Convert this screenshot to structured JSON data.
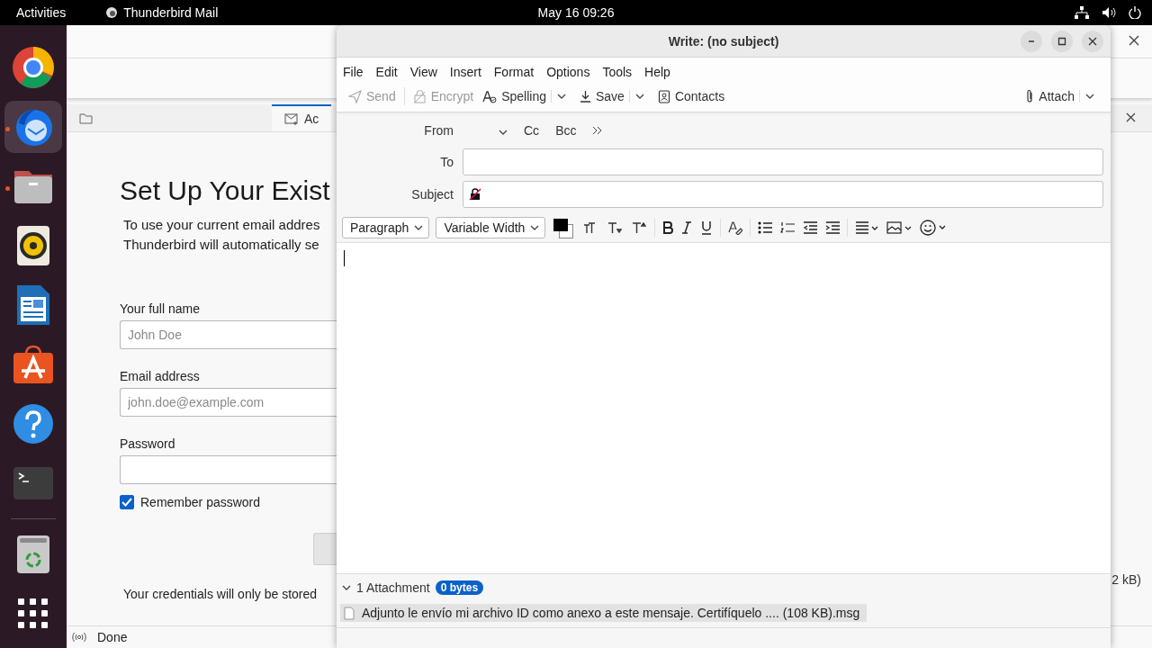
{
  "top_bar": {
    "activities": "Activities",
    "app_name": "Thunderbird Mail",
    "clock": "May 16  09:26"
  },
  "dock": {
    "items": [
      {
        "kind": "browser",
        "selected": false,
        "running": false
      },
      {
        "kind": "mail",
        "selected": true,
        "running": true
      },
      {
        "kind": "files",
        "selected": false,
        "running": true
      },
      {
        "kind": "music",
        "selected": false,
        "running": false
      },
      {
        "kind": "writer",
        "selected": false,
        "running": false
      },
      {
        "kind": "store",
        "selected": false,
        "running": false
      },
      {
        "kind": "help",
        "selected": false,
        "running": false
      },
      {
        "kind": "terminal",
        "selected": false,
        "running": false
      },
      {
        "kind": "trash",
        "selected": false,
        "running": false
      },
      {
        "kind": "apps",
        "selected": false,
        "running": false
      }
    ]
  },
  "main_window": {
    "tabs": [
      {
        "kind": "folder",
        "selected": false
      },
      {
        "kind": "account",
        "label": "Ac",
        "selected": true
      }
    ],
    "setup": {
      "heading": "Set Up Your Exist",
      "intro_lines": [
        "To use your current email addres",
        "Thunderbird will automatically se"
      ],
      "fields": [
        {
          "label": "Your full name",
          "placeholder": "John Doe"
        },
        {
          "label": "Email address",
          "placeholder": "john.doe@example.com"
        },
        {
          "label": "Password"
        }
      ],
      "remember_password": {
        "label": "Remember password",
        "checked": true
      },
      "note": "Your credentials will only be stored"
    },
    "side_text": "2 kB)",
    "status_bar": {
      "text": "Done"
    }
  },
  "compose_window": {
    "title": "Write: (no subject)",
    "menu": [
      "File",
      "Edit",
      "View",
      "Insert",
      "Format",
      "Options",
      "Tools",
      "Help"
    ],
    "toolbar": [
      {
        "kind": "send",
        "label": "Send",
        "disabled": true,
        "dropdown": false
      },
      {
        "kind": "encrypt",
        "label": "Encrypt",
        "disabled": true,
        "dropdown": false
      },
      {
        "kind": "spelling",
        "label": "Spelling",
        "disabled": false,
        "dropdown": true
      },
      {
        "kind": "save",
        "label": "Save",
        "disabled": false,
        "dropdown": true
      },
      {
        "kind": "contacts",
        "label": "Contacts",
        "disabled": false,
        "dropdown": false
      }
    ],
    "attach": {
      "label": "Attach"
    },
    "header": {
      "from_label": "From",
      "cc": "Cc",
      "bcc": "Bcc",
      "to_label": "To",
      "subject_label": "Subject"
    },
    "format": {
      "paragraph": "Paragraph",
      "font": "Variable Width"
    },
    "attachments": {
      "summary": "1 Attachment",
      "size": "0 bytes",
      "items": [
        {
          "name": "Adjunto le envío mi archivo ID como anexo a este mensaje. Certifíquelo .... (108 KB).msg",
          "selected": true
        }
      ]
    }
  }
}
